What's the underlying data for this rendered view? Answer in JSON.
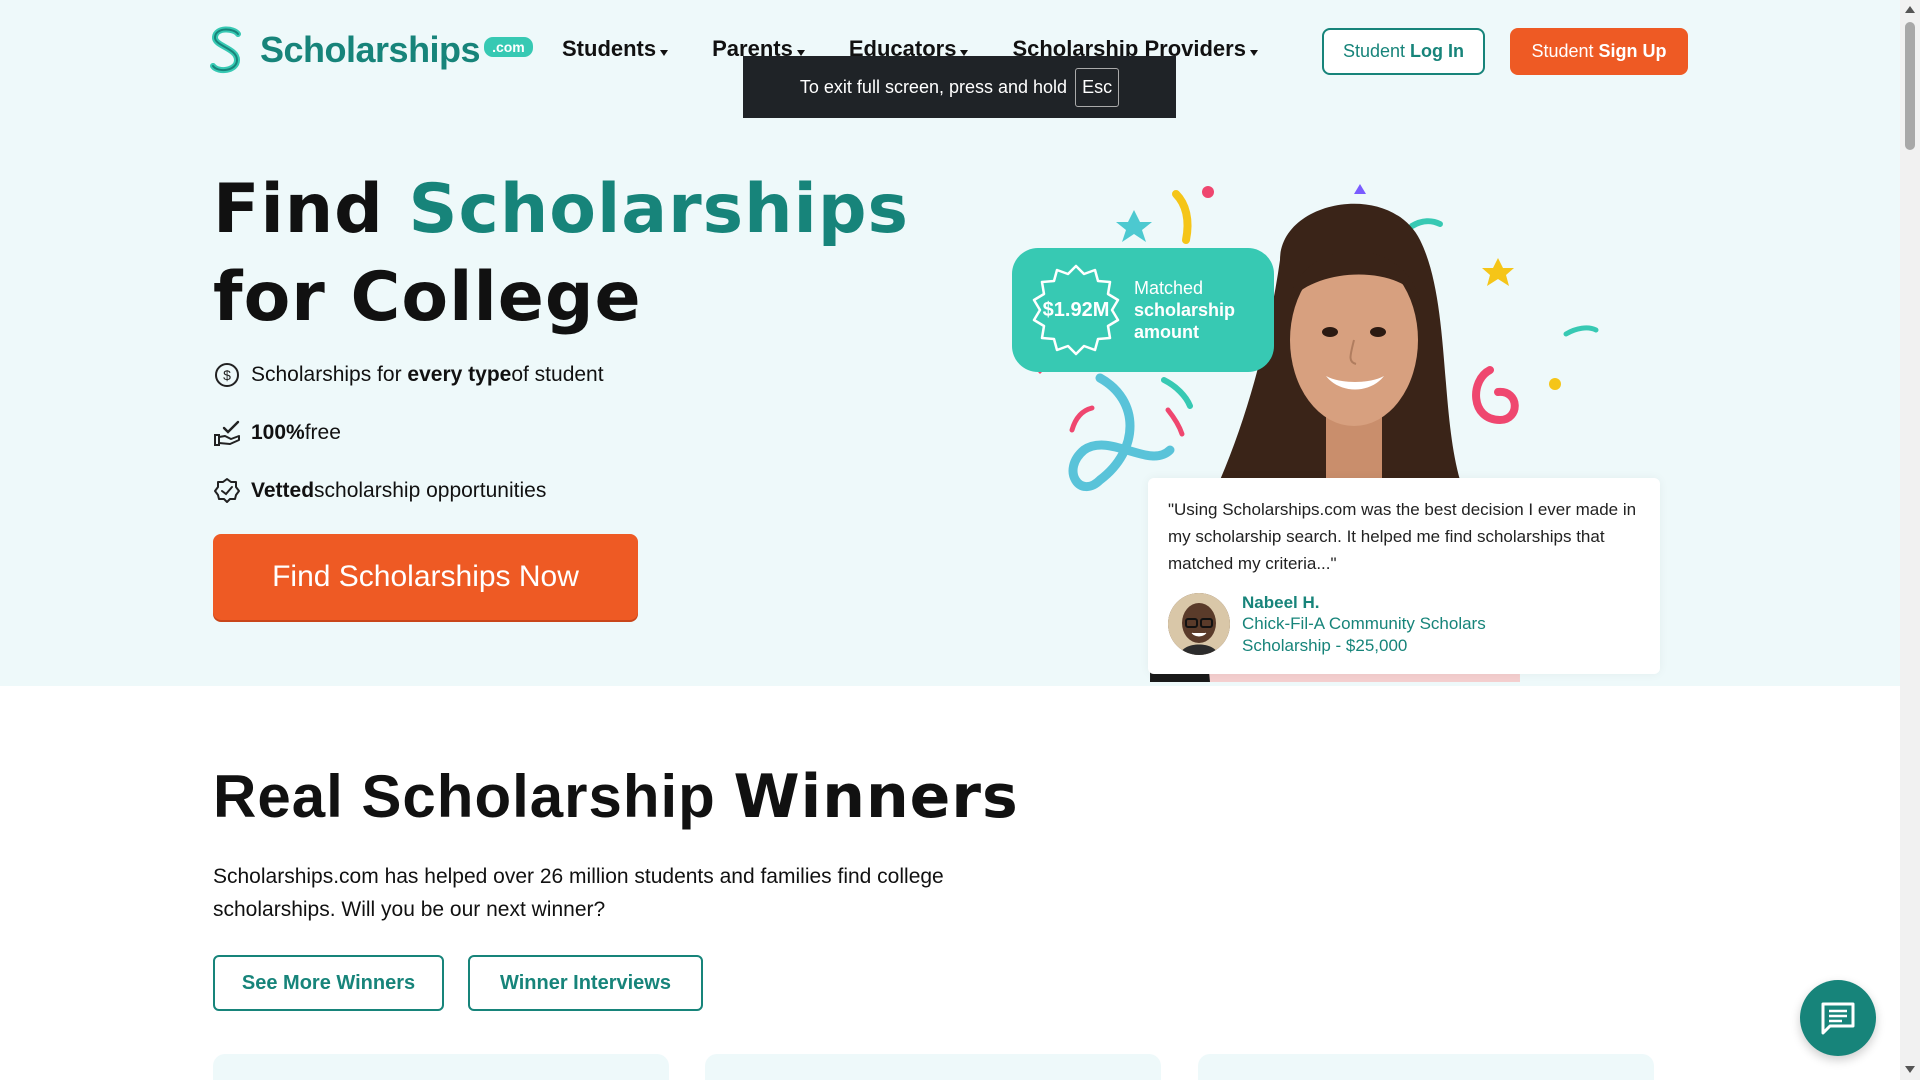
{
  "brand": {
    "name": "Scholarships",
    "tld": ".com",
    "primary_color": "#17847a",
    "accent_color": "#37c9b3",
    "cta_color": "#ee5a24"
  },
  "nav": {
    "items": [
      {
        "label": "Students"
      },
      {
        "label": "Parents"
      },
      {
        "label": "Educators"
      },
      {
        "label": "Scholarship Providers"
      }
    ]
  },
  "header": {
    "login_prefix": "Student",
    "login_bold": "Log In",
    "signup_prefix": "Student",
    "signup_bold": "Sign Up"
  },
  "fullscreen_notice": {
    "text": "To exit full screen, press and hold",
    "key": "Esc"
  },
  "hero": {
    "title_part1": "Find ",
    "title_accent": "Scholarships",
    "title_part2": "for College",
    "features": [
      {
        "icon": "dollar-circle-icon",
        "pre": "Scholarships for ",
        "bold": "every type",
        "post": " of student"
      },
      {
        "icon": "hand-check-icon",
        "pre": "",
        "bold": "100%",
        "post": " free"
      },
      {
        "icon": "award-ribbon-icon",
        "pre": "",
        "bold": "Vetted",
        "post": " scholarship opportunities"
      }
    ],
    "cta_label": "Find Scholarships Now",
    "badge": {
      "amount": "$1.92M",
      "line1": "Matched",
      "line2": "scholarship",
      "line3": "amount"
    },
    "testimonial": {
      "quote": "\"Using Scholarships.com was the best decision I ever made in my scholarship search. It helped me find scholarships that matched my criteria...\"",
      "name": "Nabeel H.",
      "award": "Chick-Fil-A Community Scholars Scholarship - $25,000"
    }
  },
  "winners": {
    "title_light": "Real Scholarship ",
    "title_bold": "Winners",
    "description": "Scholarships.com has helped over 26 million students and families find college scholarships. Will you be our next winner?",
    "btn_more": "See More Winners",
    "btn_interviews": "Winner Interviews"
  }
}
